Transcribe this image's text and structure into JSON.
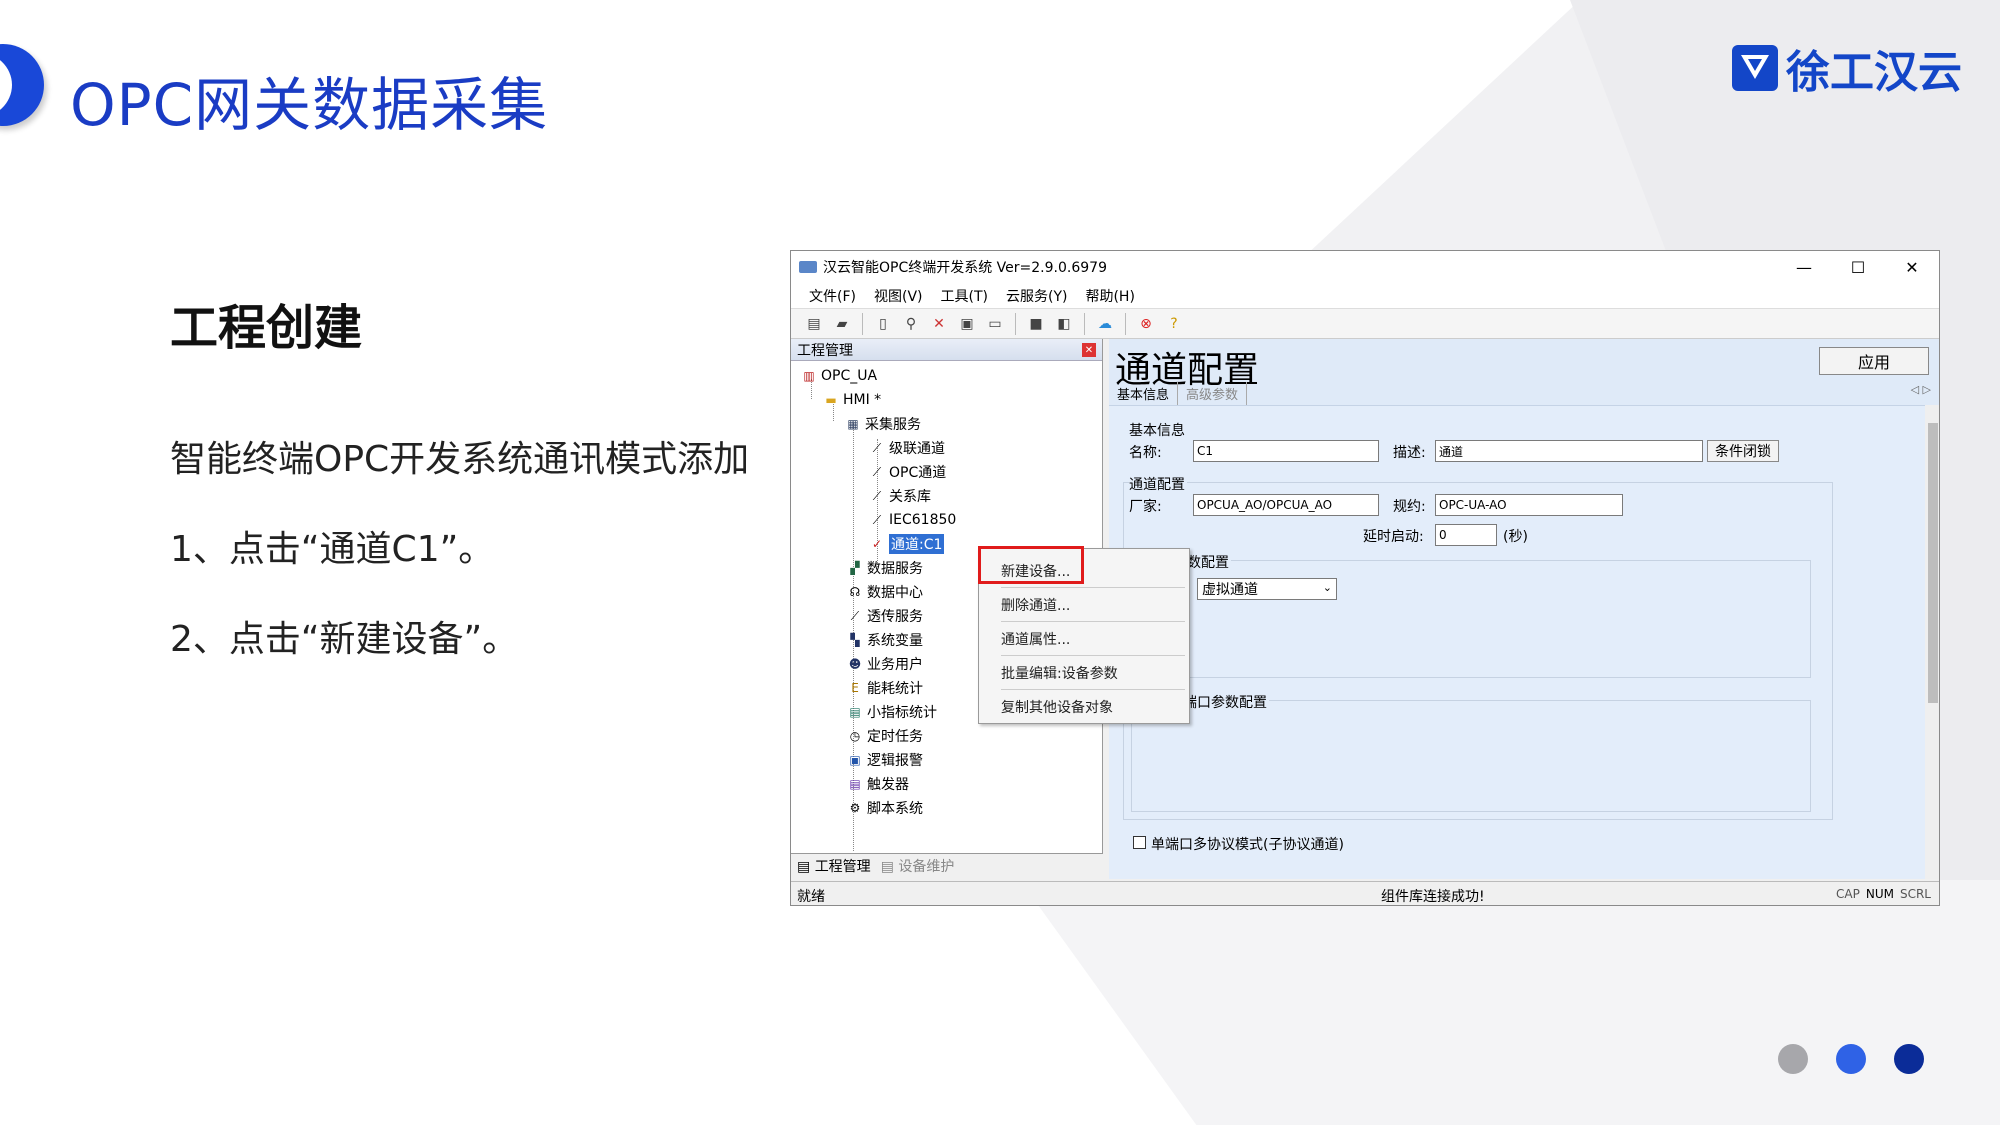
{
  "slide": {
    "title": "OPC网关数据采集",
    "logo_text": "徐工汉云",
    "heading": "工程创建",
    "lines": [
      "智能终端OPC开发系统通讯模式添加",
      "1、点击“通道C1”。",
      "2、点击“新建设备”。"
    ],
    "dot_colors": [
      "#a7a7ab",
      "#2f62e6",
      "#0b2c98"
    ]
  },
  "window": {
    "title": "汉云智能OPC终端开发系统 Ver=2.9.0.6979",
    "controls": [
      "—",
      "☐",
      "✕"
    ],
    "menu": [
      "文件(F)",
      "视图(V)",
      "工具(T)",
      "云服务(Y)",
      "帮助(H)"
    ],
    "left_pane_title": "工程管理",
    "tree": [
      {
        "label": "OPC_UA",
        "icon": "project-icon"
      },
      {
        "label": "HMI *",
        "icon": "folder-icon"
      },
      {
        "label": "采集服务",
        "icon": "collect-service-icon"
      },
      {
        "label": "级联通道",
        "icon": "channel-icon"
      },
      {
        "label": "OPC通道",
        "icon": "channel-icon"
      },
      {
        "label": "关系库",
        "icon": "channel-icon"
      },
      {
        "label": "IEC61850",
        "icon": "channel-icon"
      },
      {
        "label": "通道:C1",
        "icon": "check-icon"
      },
      {
        "label": "数据服务",
        "icon": "data-service-icon"
      },
      {
        "label": "数据中心",
        "icon": "data-center-icon"
      },
      {
        "label": "透传服务",
        "icon": "passthrough-icon"
      },
      {
        "label": "系统变量",
        "icon": "sysvar-icon"
      },
      {
        "label": "业务用户",
        "icon": "user-icon"
      },
      {
        "label": "能耗统计",
        "icon": "energy-icon"
      },
      {
        "label": "小指标统计",
        "icon": "stats-icon"
      },
      {
        "label": "定时任务",
        "icon": "clock-icon"
      },
      {
        "label": "逻辑报警",
        "icon": "alarm-icon"
      },
      {
        "label": "触发器",
        "icon": "trigger-icon"
      },
      {
        "label": "脚本系统",
        "icon": "script-icon"
      }
    ],
    "bottom_tabs": [
      "工程管理",
      "设备维护"
    ],
    "status_left": "就绪",
    "status_mid": "组件库连接成功!",
    "status_right": [
      "CAP",
      "NUM",
      "SCRL"
    ]
  },
  "config": {
    "title": "通道配置",
    "apply_label": "应用",
    "tabs": [
      "基本信息",
      "高级参数"
    ],
    "basic_group": "基本信息",
    "name_label": "名称:",
    "name_value": "C1",
    "desc_label": "描述:",
    "desc_value": "通道",
    "cond_lock_label": "条件闭锁",
    "channel_group": "通道配置",
    "vendor_label": "厂家:",
    "vendor_value": "OPCUA_AO/OPCUA_AO",
    "protocol_label": "规约:",
    "protocol_value": "OPC-UA-AO",
    "delay_label": "延时启动:",
    "delay_value": "0",
    "delay_unit": "(秒)",
    "param_group": "参数配置",
    "channel_type_value": "虚拟通道",
    "port_group": "启用端口参数配置",
    "multi_protocol_label": "单端口多协议模式(子协议通道)"
  },
  "context_menu": [
    "新建设备...",
    "删除通道...",
    "通道属性...",
    "批量编辑:设备参数",
    "复制其他设备对象"
  ]
}
